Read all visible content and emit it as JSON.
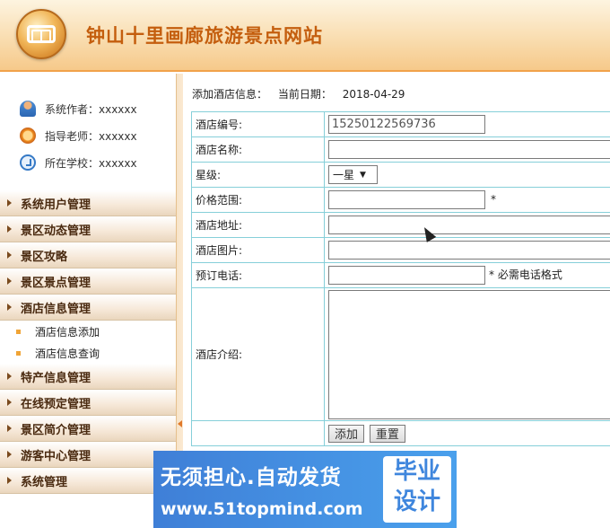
{
  "header": {
    "title": "钟山十里画廊旅游景点网站"
  },
  "sidebar": {
    "info": [
      {
        "label": "系统作者：xxxxxx",
        "icon": "author-icon"
      },
      {
        "label": "指导老师：xxxxxx",
        "icon": "teacher-icon"
      },
      {
        "label": "所在学校：xxxxxx",
        "icon": "school-icon"
      }
    ],
    "menu": [
      {
        "label": "系统用户管理"
      },
      {
        "label": "景区动态管理"
      },
      {
        "label": "景区攻略"
      },
      {
        "label": "景区景点管理"
      },
      {
        "label": "酒店信息管理",
        "expanded": true,
        "children": [
          "酒店信息添加",
          "酒店信息查询"
        ]
      },
      {
        "label": "特产信息管理"
      },
      {
        "label": "在线预定管理"
      },
      {
        "label": "景区简介管理"
      },
      {
        "label": "游客中心管理"
      },
      {
        "label": "系统管理"
      }
    ]
  },
  "main": {
    "page_label": "添加酒店信息：",
    "date_label": "当前日期：",
    "date_value": "2018-04-29",
    "form": {
      "hotel_id_label": "酒店编号:",
      "hotel_id_value": "15250122569736",
      "hotel_name_label": "酒店名称:",
      "star_label": "星级:",
      "star_value": "一星",
      "price_label": "价格范围:",
      "price_required": "*",
      "address_label": "酒店地址:",
      "image_label": "酒店图片:",
      "phone_label": "预订电话:",
      "phone_hint": "* 必需电话格式",
      "intro_label": "酒店介绍:",
      "add_button": "添加",
      "reset_button": "重置"
    }
  },
  "watermark": {
    "slogan": "无须担心.自动发货",
    "url": "www.51topmind.com",
    "badge_line1": "毕业",
    "badge_line2": "设计"
  }
}
